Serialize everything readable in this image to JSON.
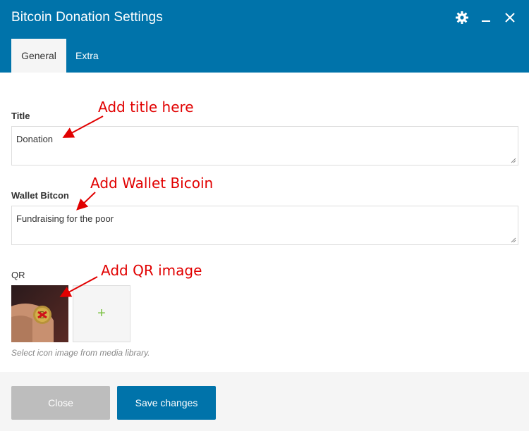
{
  "header": {
    "title": "Bitcoin Donation Settings",
    "icons": [
      "gear-icon",
      "minimize-icon",
      "close-icon"
    ],
    "bg_color": "#0073aa"
  },
  "tabs": [
    {
      "label": "General",
      "active": true
    },
    {
      "label": "Extra",
      "active": false
    }
  ],
  "fields": {
    "title": {
      "label": "Title",
      "value": "Donation"
    },
    "wallet": {
      "label": "Wallet Bitcon",
      "value": "Fundraising for the poor"
    },
    "qr": {
      "label": "QR",
      "hint": "Select icon image from media library.",
      "add_symbol": "+"
    }
  },
  "annotations": {
    "title": "Add title here",
    "wallet": "Add Wallet Bicoin",
    "qr": "Add QR image"
  },
  "footer": {
    "close_label": "Close",
    "save_label": "Save changes"
  }
}
